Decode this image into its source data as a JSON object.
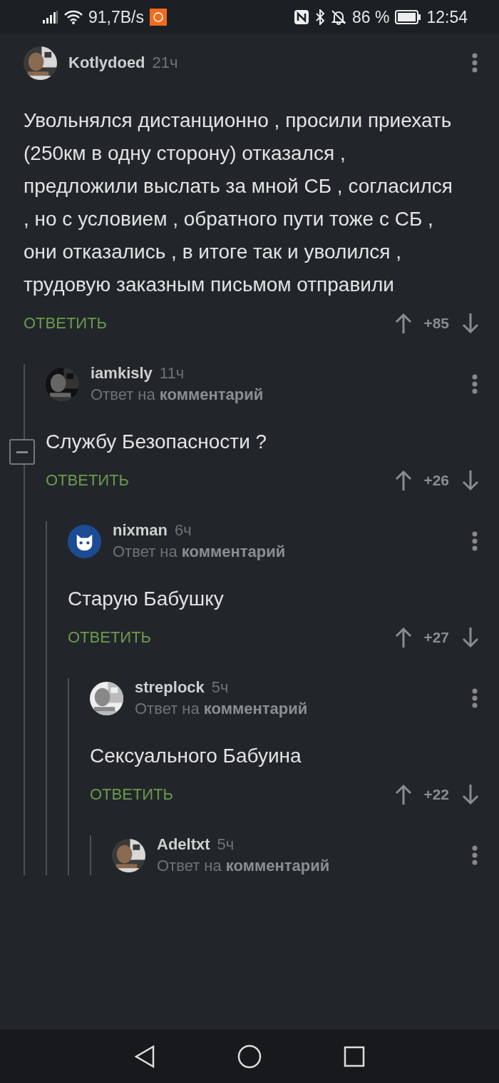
{
  "status_bar": {
    "speed": "91,7B/s",
    "battery": "86 %",
    "time": "12:54"
  },
  "comments": [
    {
      "author": "Kotlydoed",
      "time": "21ч",
      "text": "Увольнялся дистанционно , просили приехать (250км в одну сторону) отказался , предложили выслать за мной СБ , согласился , но с условием , обратного пути тоже с СБ , они отказались , в итоге так и уволился , трудовую заказным письмом отправили",
      "reply": "ОТВЕТИТЬ",
      "score": "+85",
      "expanded": true,
      "children": [
        {
          "author": "iamkisly",
          "time": "11ч",
          "reply_to": "Ответ на **комментарий**",
          "text": "Службу Безопасности ?",
          "reply": "ОТВЕТИТЬ",
          "score": "+26",
          "children": [
            {
              "author": "nixman",
              "time": "6ч",
              "avatar": {
                "kind": "cat"
              },
              "reply_to": "Ответ на **комментарий**",
              "text": "Старую Бабушку",
              "reply": "ОТВЕТИТЬ",
              "score": "+27",
              "children": [
                {
                  "author": "streplock",
                  "time": "5ч",
                  "reply_to": "Ответ на **комментарий**",
                  "text": "Сексуального Бабуина",
                  "reply": "ОТВЕТИТЬ",
                  "score": "+22",
                  "children": [
                    {
                      "author": "Adeltxt",
                      "time": "5ч",
                      "reply_to": "Ответ на **комментарий**"
                    }
                  ]
                }
              ]
            }
          ]
        }
      ]
    }
  ]
}
